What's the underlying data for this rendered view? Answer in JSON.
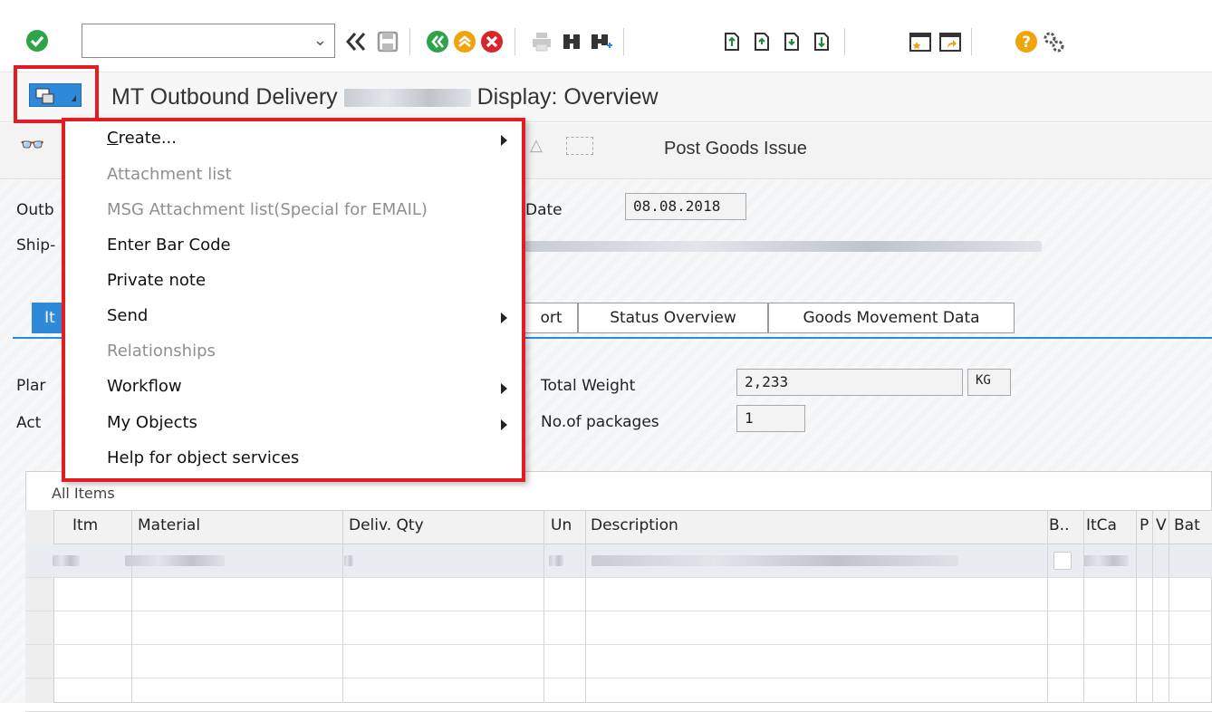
{
  "toolbar": {
    "command_field_value": "",
    "icons": [
      "enter-icon",
      "back-double-icon",
      "save-icon",
      "back-icon",
      "exit-icon",
      "cancel-icon",
      "print-icon",
      "find-icon",
      "find-next-icon",
      "first-page-icon",
      "previous-page-icon",
      "next-page-icon",
      "last-page-icon",
      "create-session-icon",
      "shortcut-icon",
      "help-icon",
      "settings-icon"
    ]
  },
  "title": {
    "prefix": "MT Outbound Delivery",
    "suffix": "Display: Overview"
  },
  "app_toolbar": {
    "post_goods_issue": "Post Goods Issue"
  },
  "header_fields": {
    "outbound_label": "Outb",
    "ship_label": "Ship-",
    "date_label": "Date",
    "date_value": "08.08.2018"
  },
  "tabs": [
    {
      "label": "It",
      "active": true
    },
    {
      "label": "ort",
      "active": false
    },
    {
      "label": "Status Overview",
      "active": false
    },
    {
      "label": "Goods Movement Data",
      "active": false
    }
  ],
  "fields": {
    "plan_label": "Plar",
    "act_label": "Act",
    "total_weight_label": "Total Weight",
    "total_weight_value": "2,233",
    "weight_unit": "KG",
    "packages_label": "No.of packages",
    "packages_value": "1"
  },
  "table": {
    "title": "All Items",
    "columns": [
      "Itm",
      "Material",
      "Deliv. Qty",
      "Un",
      "Description",
      "B..",
      "ItCa",
      "P",
      "V",
      "Bat"
    ]
  },
  "menu": {
    "items": [
      {
        "label": "Create...",
        "enabled": true,
        "submenu": true
      },
      {
        "label": "Attachment list",
        "enabled": false,
        "submenu": false
      },
      {
        "label": "MSG Attachment list(Special for EMAIL)",
        "enabled": false,
        "submenu": false
      },
      {
        "label": "Enter Bar Code",
        "enabled": true,
        "submenu": false
      },
      {
        "label": "Private note",
        "enabled": true,
        "submenu": false
      },
      {
        "label": "Send",
        "enabled": true,
        "submenu": true
      },
      {
        "label": "Relationships",
        "enabled": false,
        "submenu": false
      },
      {
        "label": "Workflow",
        "enabled": true,
        "submenu": true
      },
      {
        "label": "My Objects",
        "enabled": true,
        "submenu": true
      },
      {
        "label": "Help for object services",
        "enabled": true,
        "submenu": false
      }
    ]
  },
  "colors": {
    "accent": "#2e8ad8",
    "highlight": "#e31b23"
  }
}
